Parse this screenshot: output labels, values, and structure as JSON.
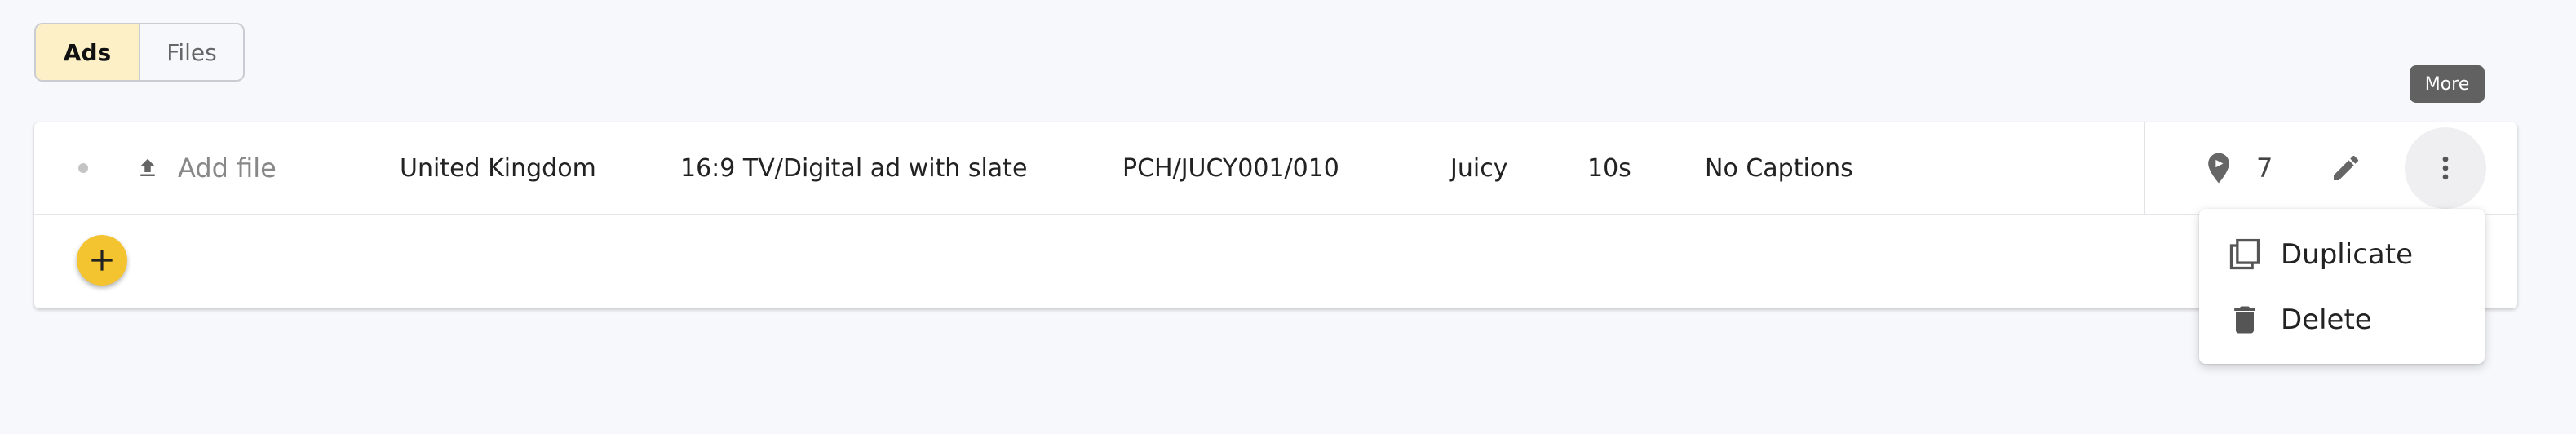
{
  "toggle": {
    "ads_label": "Ads",
    "files_label": "Files",
    "selected": "Ads"
  },
  "tooltip": {
    "text": "More"
  },
  "row": {
    "add_file_label": "Add file",
    "country": "United Kingdom",
    "format": "16:9 TV/Digital ad with slate",
    "code": "PCH/JUCY001/010",
    "brand": "Juicy",
    "duration": "10s",
    "captions": "No Captions",
    "location_count": "7"
  },
  "menu": {
    "items": [
      {
        "label": "Duplicate",
        "icon": "duplicate-icon"
      },
      {
        "label": "Delete",
        "icon": "trash-icon"
      }
    ]
  },
  "colors": {
    "accent": "#f4c430",
    "toggle_active_bg": "#fdf0c6",
    "tooltip_bg": "#616161",
    "background": "#f7f8fc"
  },
  "icons": [
    "upload-icon",
    "location-pin-icon",
    "edit-icon",
    "more-vertical-icon",
    "plus-icon",
    "duplicate-icon",
    "trash-icon"
  ]
}
